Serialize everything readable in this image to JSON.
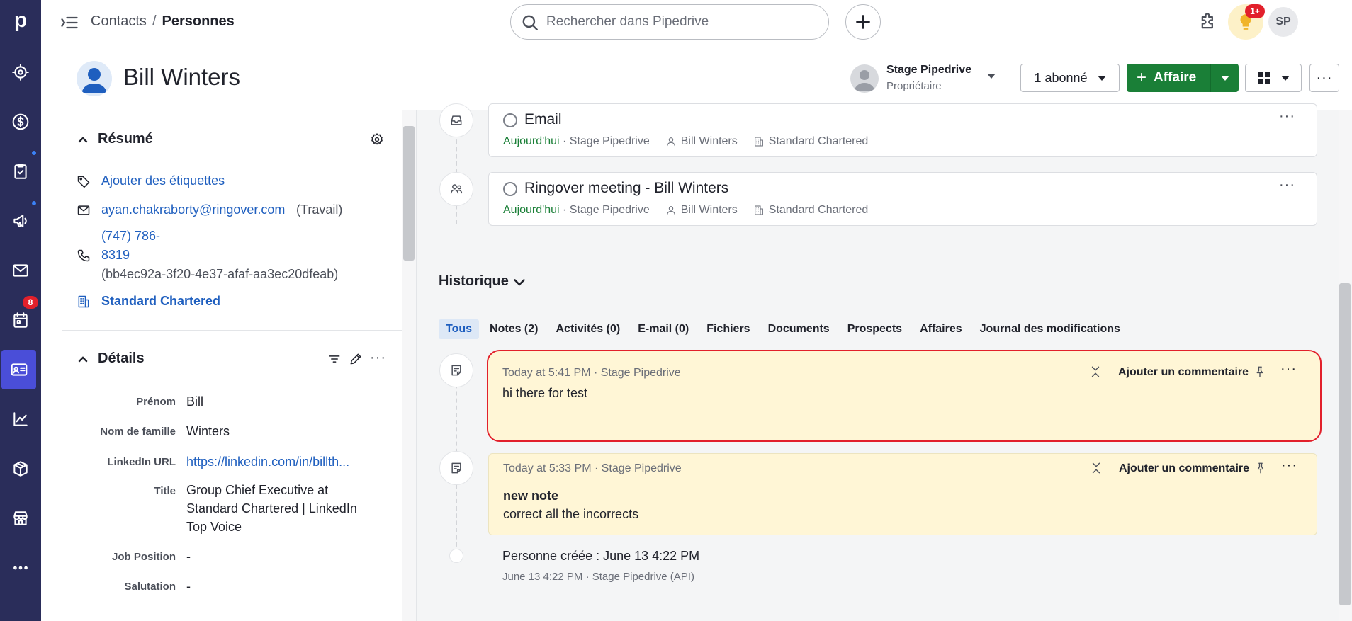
{
  "nav": {
    "logo": "p",
    "items": [
      {
        "icon": "target-icon",
        "name": "leads"
      },
      {
        "icon": "dollar-icon",
        "name": "deals"
      },
      {
        "icon": "clipboard-check-icon",
        "name": "activities"
      },
      {
        "icon": "megaphone-icon",
        "name": "campaigns"
      },
      {
        "icon": "mail-icon",
        "name": "mail"
      },
      {
        "icon": "calendar-icon",
        "name": "calendar"
      },
      {
        "icon": "contact-card-icon",
        "name": "contacts"
      },
      {
        "icon": "chart-line-icon",
        "name": "insights"
      },
      {
        "icon": "box-icon",
        "name": "products"
      },
      {
        "icon": "store-icon",
        "name": "marketplace"
      },
      {
        "icon": "more-dots-icon",
        "name": "more"
      }
    ],
    "calendar_badge": "8",
    "colors": {
      "rail": "#2a2d5a",
      "active": "#4a4ed8"
    }
  },
  "topbar": {
    "breadcrumb_parent": "Contacts",
    "breadcrumb_sep": "/",
    "breadcrumb_current": "Personnes",
    "search_placeholder": "Rechercher dans Pipedrive",
    "notif_badge": "1+",
    "user_initials": "SP"
  },
  "person": {
    "name": "Bill Winters",
    "owner_name": "Stage Pipedrive",
    "owner_role": "Propriétaire",
    "followers_label": "1 abonné",
    "deal_button": "Affaire"
  },
  "summary": {
    "title": "Résumé",
    "add_labels": "Ajouter des étiquettes",
    "email": "ayan.chakraborty@ringover.com",
    "email_type": "(Travail)",
    "phone_line1": "(747) 786-",
    "phone_line2": "8319",
    "phone_id": "(bb4ec92a-3f20-4e37-afaf-aa3ec20dfeab)",
    "organization": "Standard Chartered"
  },
  "details": {
    "title": "Détails",
    "fields": [
      {
        "label": "Prénom",
        "value": "Bill"
      },
      {
        "label": "Nom de famille",
        "value": "Winters"
      },
      {
        "label": "LinkedIn URL",
        "value": "https://linkedin.com/in/billth..."
      },
      {
        "label": "Title",
        "value_lines": [
          "Group Chief Executive at",
          "Standard Chartered | LinkedIn",
          "Top Voice"
        ]
      },
      {
        "label": "Job Position",
        "value": "-"
      },
      {
        "label": "Salutation",
        "value": "-"
      }
    ]
  },
  "activities": [
    {
      "title": "Email",
      "when": "Aujourd'hui",
      "owner": "Stage Pipedrive",
      "person": "Bill Winters",
      "org": "Standard Chartered",
      "icon": "inbox-icon"
    },
    {
      "title": "Ringover meeting - Bill Winters",
      "when": "Aujourd'hui",
      "owner": "Stage Pipedrive",
      "person": "Bill Winters",
      "org": "Standard Chartered",
      "icon": "people-icon"
    }
  ],
  "history": {
    "title": "Historique",
    "tabs": [
      "Tous",
      "Notes (2)",
      "Activités (0)",
      "E-mail (0)",
      "Fichiers",
      "Documents",
      "Prospects",
      "Affaires",
      "Journal des modifications"
    ],
    "active_tab": "Tous",
    "notes": [
      {
        "when": "Today at 5:41 PM · Stage Pipedrive",
        "line1": "hi there for test",
        "line2": "",
        "comment": "Ajouter un commentaire",
        "highlight": true
      },
      {
        "when": "Today at 5:33 PM · Stage Pipedrive",
        "line1": "new note",
        "line2": "correct all the incorrects",
        "comment": "Ajouter un commentaire",
        "highlight": false
      }
    ],
    "created_title": "Personne créée : June 13 4:22 PM",
    "created_meta": "June 13 4:22 PM · Stage Pipedrive (API)"
  }
}
